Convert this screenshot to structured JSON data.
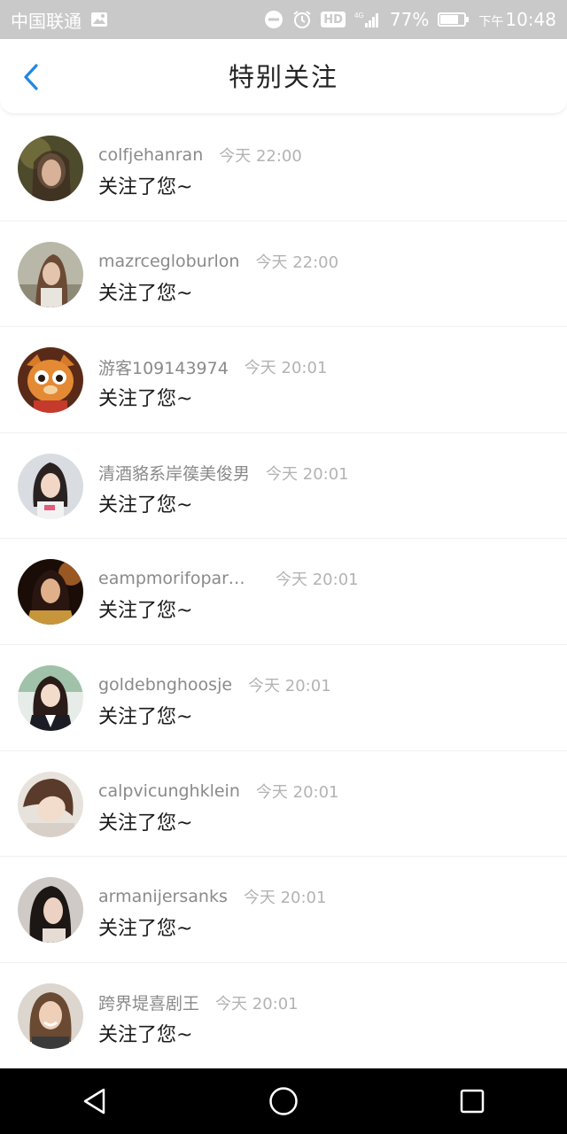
{
  "status_bar": {
    "carrier": "中国联通",
    "network": "4G",
    "battery": "77%",
    "time_prefix": "下午",
    "time": "10:48"
  },
  "header": {
    "title": "特别关注",
    "back_icon": "chevron-left-icon"
  },
  "notifications": [
    {
      "name": "colfjehanran",
      "time": "今天 22:00",
      "message": "关注了您~"
    },
    {
      "name": "mazrcegloburlon",
      "time": "今天 22:00",
      "message": "关注了您~"
    },
    {
      "name": "游客109143974",
      "time": "今天 20:01",
      "message": "关注了您~"
    },
    {
      "name": "清酒貉系岸篌美俊男",
      "time": "今天 20:01",
      "message": "关注了您~"
    },
    {
      "name": "eampmorifoparm...",
      "time": "今天 20:01",
      "message": "关注了您~"
    },
    {
      "name": "goldebnghoosje",
      "time": "今天 20:01",
      "message": "关注了您~"
    },
    {
      "name": "calpvicunghklein",
      "time": "今天 20:01",
      "message": "关注了您~"
    },
    {
      "name": "armanijersanks",
      "time": "今天 20:01",
      "message": "关注了您~"
    },
    {
      "name": "跨界堤喜剧王",
      "time": "今天 20:01",
      "message": "关注了您~"
    }
  ],
  "nav": {
    "back": "triangle-back-icon",
    "home": "circle-home-icon",
    "recents": "square-recents-icon"
  },
  "colors": {
    "accent": "#1e88e5",
    "status_bar": "#c9c9c9",
    "nav_bar": "#000000"
  }
}
